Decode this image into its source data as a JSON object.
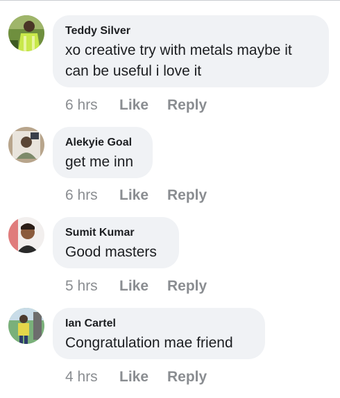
{
  "colors": {
    "bubble_bg": "#f0f2f5",
    "text": "#1c1e21",
    "meta": "#8a8d91"
  },
  "comments": [
    {
      "author": "Teddy Silver",
      "text_lines": [
        "xo creative try with metals maybe it",
        "can be useful i love it"
      ],
      "time": "6 hrs",
      "like_label": "Like",
      "reply_label": "Reply",
      "avatar_icon": "profile-photo-icon"
    },
    {
      "author": "Alekyie Goal",
      "text_lines": [
        "get me inn"
      ],
      "time": "6 hrs",
      "like_label": "Like",
      "reply_label": "Reply",
      "avatar_icon": "profile-photo-icon"
    },
    {
      "author": "Sumit Kumar",
      "text_lines": [
        "Good masters"
      ],
      "time": "5 hrs",
      "like_label": "Like",
      "reply_label": "Reply",
      "avatar_icon": "profile-photo-icon"
    },
    {
      "author": "Ian Cartel",
      "text_lines": [
        "Congratulation mae friend"
      ],
      "time": "4 hrs",
      "like_label": "Like",
      "reply_label": "Reply",
      "avatar_icon": "profile-photo-icon"
    }
  ]
}
